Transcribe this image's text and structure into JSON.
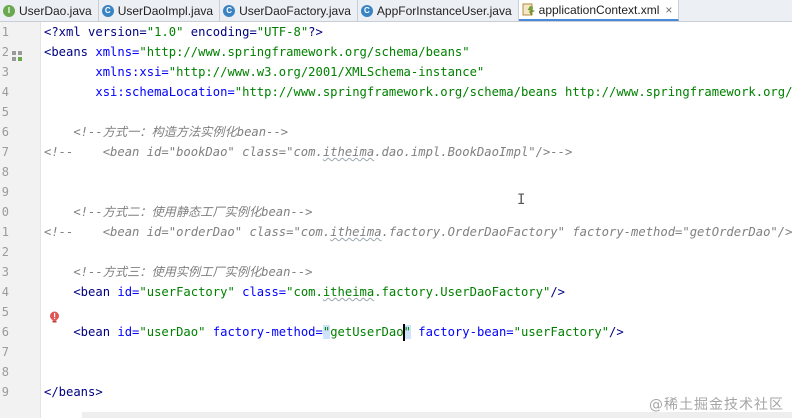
{
  "tabs": [
    {
      "label": "UserDao.java",
      "icon": "interface-icon",
      "active": false
    },
    {
      "label": "UserDaoImpl.java",
      "icon": "class-icon",
      "active": false
    },
    {
      "label": "UserDaoFactory.java",
      "icon": "class-icon",
      "active": false
    },
    {
      "label": "AppForInstanceUser.java",
      "icon": "class-icon",
      "active": false
    },
    {
      "label": "applicationContext.xml",
      "icon": "xml-file-icon",
      "active": true,
      "close": "×"
    }
  ],
  "gutter": {
    "line_numbers": [
      "1",
      "2",
      "3",
      "4",
      "5",
      "6",
      "7",
      "8",
      "9",
      "0",
      "1",
      "2",
      "3",
      "4",
      "5",
      "6",
      "7",
      "8",
      "9"
    ]
  },
  "code": {
    "l1": {
      "a": "<?xml version=",
      "b": "\"1.0\"",
      "c": " encoding=",
      "d": "\"UTF-8\"",
      "e": "?>"
    },
    "l2": {
      "a": "<beans ",
      "b": "xmlns=",
      "c": "\"http://www.springframework.org/schema/beans\""
    },
    "l3": {
      "a": "       ",
      "b": "xmlns:xsi=",
      "c": "\"http://www.w3.org/2001/XMLSchema-instance\""
    },
    "l4": {
      "a": "       ",
      "b": "xsi:schemaLocation=",
      "c": "\"http://www.springframework.org/schema/beans http://www.springframework.org/s"
    },
    "l6": "    <!--方式一：构造方法实例化bean-->",
    "l7": {
      "a": "<!--    <bean id=\"bookDao\" class=\"com.",
      "b": "itheima",
      "c": ".dao.impl.BookDaoImpl\"/>-->"
    },
    "l10": "    <!--方式二：使用静态工厂实例化bean-->",
    "l11": {
      "a": "<!--    <bean id=\"orderDao\" class=\"com.",
      "b": "itheima",
      "c": ".factory.OrderDaoFactory\" factory-method=\"getOrderDao\"/>-"
    },
    "l13": "    <!--方式三：使用实例工厂实例化bean-->",
    "l14": {
      "a": "    <bean ",
      "b": "id=",
      "c": "\"userFactory\"",
      "d": " class=",
      "e": "\"com.",
      "f": "itheima",
      "g": ".factory.UserDaoFactory\"",
      "h": "/>"
    },
    "l16": {
      "a": "    <bean ",
      "b": "id=",
      "c": "\"userDao\"",
      "d": " factory-method=",
      "e": "\"",
      "f": "getUserDao",
      "g": "\"",
      "h": " factory-bean=",
      "i": "\"userFactory\"",
      "j": "/>"
    },
    "l19": "</beans>"
  },
  "watermark": "@稀土掘金技术社区",
  "colors": {
    "tag": "#000080",
    "attribute": "#0000ff",
    "value": "#008000",
    "comment": "#808080",
    "active_tab_underline": "#4a88d8",
    "selection": "#cfe3ff"
  }
}
